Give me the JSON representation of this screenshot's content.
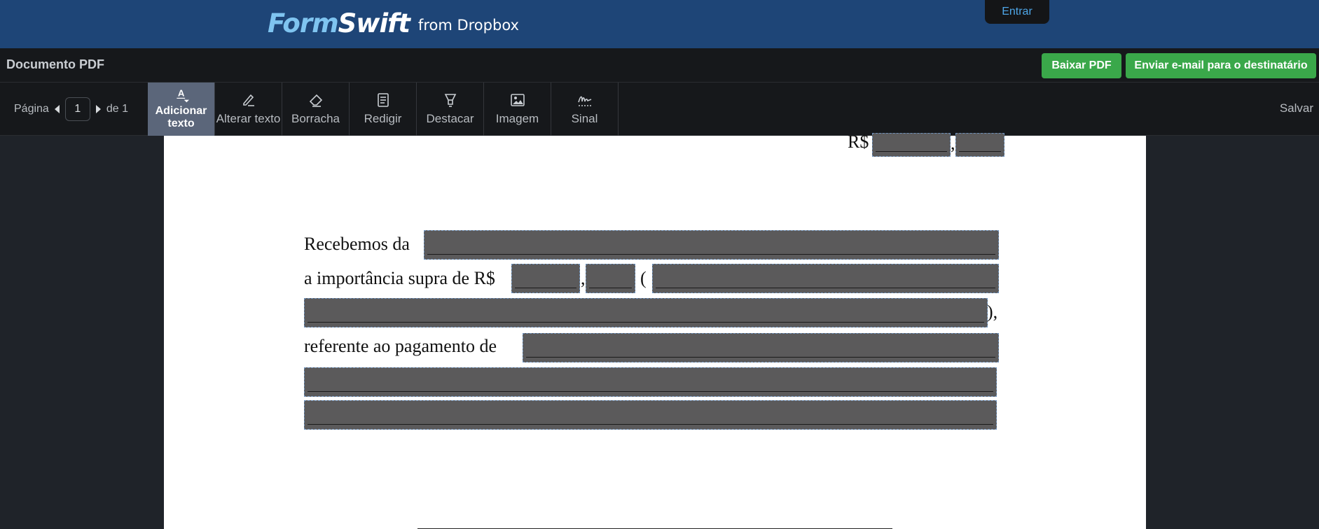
{
  "brand": {
    "logo_form": "Form",
    "logo_swift": "Swift",
    "logo_from": "from Dropbox"
  },
  "header": {
    "login_label": "Entrar"
  },
  "docbar": {
    "title": "Documento PDF",
    "download_label": "Baixar PDF",
    "email_label": "Enviar e-mail para o destinatário"
  },
  "pager": {
    "page_label": "Página",
    "current_page": "1",
    "total_label": "de 1"
  },
  "tools": [
    {
      "label": "Adicionar texto",
      "icon": "add-text-icon"
    },
    {
      "label": "Alterar texto",
      "icon": "edit-text-icon"
    },
    {
      "label": "Borracha",
      "icon": "eraser-icon"
    },
    {
      "label": "Redigir",
      "icon": "redact-icon"
    },
    {
      "label": "Destacar",
      "icon": "highlight-icon"
    },
    {
      "label": "Imagem",
      "icon": "image-icon"
    },
    {
      "label": "Sinal",
      "icon": "signature-icon"
    }
  ],
  "save_label": "Salvar",
  "document": {
    "currency_label": "R$",
    "comma": ",",
    "line1": "Recebemos da",
    "line2_prefix": "a importância supra de R$",
    "line2_comma": ",",
    "open_paren": "(",
    "close_paren": "),",
    "line4": "referente ao pagamento de"
  }
}
